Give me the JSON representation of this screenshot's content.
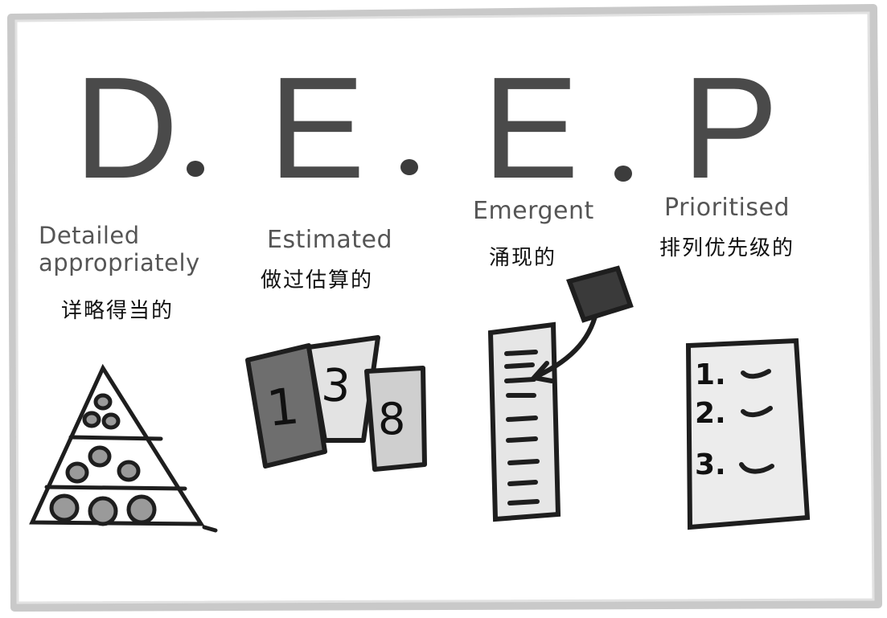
{
  "letters": [
    "D",
    "E",
    "E",
    "P"
  ],
  "items": [
    {
      "en": "Detailed appropriately",
      "zh": "详略得当的"
    },
    {
      "en": "Estimated",
      "zh": "做过估算的"
    },
    {
      "en": "Emergent",
      "zh": "涌现的"
    },
    {
      "en": "Prioritised",
      "zh": "排列优先级的"
    }
  ],
  "cards": [
    "1",
    "3",
    "8"
  ],
  "priority_list": [
    "1.",
    "2.",
    "3."
  ],
  "colors": {
    "ink": "#222222",
    "pencil": "#555555",
    "card_dark": "#6e6e6e",
    "card_light": "#e3e3e3",
    "paper_fill": "#ececec",
    "frame": "#cfcfcf"
  }
}
